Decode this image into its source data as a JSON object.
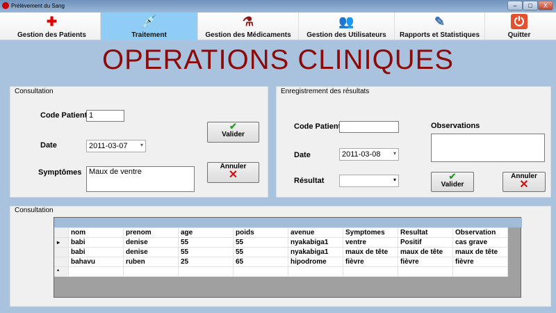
{
  "window": {
    "title": "Prélèvement du Sang",
    "minimize": "–",
    "maximize": "□",
    "close": "X"
  },
  "toolbar": {
    "items": [
      {
        "label": "Gestion des Patients",
        "icon": "red-cross-icon",
        "glyph": "✚"
      },
      {
        "label": "Traitement",
        "icon": "syringe-icon",
        "glyph": "💉",
        "selected": true
      },
      {
        "label": "Gestion des Médicaments",
        "icon": "test-tubes-icon",
        "glyph": "⚗"
      },
      {
        "label": "Gestion des Utilisateurs",
        "icon": "users-icon",
        "glyph": "👥"
      },
      {
        "label": "Rapports et Statistiques",
        "icon": "report-icon",
        "glyph": "✎"
      },
      {
        "label": "Quitter",
        "icon": "power-icon",
        "glyph": "⏻"
      }
    ],
    "selected_color": "#8fcdf6"
  },
  "page_title": "OPERATIONS CLINIQUES",
  "title_color": "#8b0a0a",
  "consultation": {
    "title": "Consultation",
    "code_label": "Code Patient",
    "code_value": "1",
    "date_label": "Date",
    "date_value": "2011-03-07",
    "symptoms_label": "Symptômes",
    "symptoms_value": "Maux de ventre",
    "validate": "Valider",
    "cancel": "Annuler"
  },
  "results": {
    "title": "Enregistrement des résultats",
    "code_label": "Code Patient",
    "code_value": "",
    "date_label": "Date",
    "date_value": "2011-03-08",
    "result_label": "Résultat",
    "result_value": "",
    "observations_label": "Observations",
    "observations_value": "",
    "validate": "Valider",
    "cancel": "Annuler"
  },
  "table": {
    "title": "Consultation",
    "columns": [
      "nom",
      "prenom",
      "age",
      "poids",
      "avenue",
      "Symptomes",
      "Resultat",
      "Observation"
    ],
    "rows": [
      [
        "babi",
        "denise",
        "55",
        "55",
        "nyakabiga1",
        "ventre",
        "Positif",
        "cas grave"
      ],
      [
        "babi",
        "denise",
        "55",
        "55",
        "nyakabiga1",
        "maux de tête",
        "maux de tête",
        "maux de tête"
      ],
      [
        "bahavu",
        "ruben",
        "25",
        "65",
        "hipodrome",
        "fièvre",
        "fièvre",
        "fièvre"
      ]
    ],
    "current_marker": "▸",
    "new_row_marker": "*"
  }
}
